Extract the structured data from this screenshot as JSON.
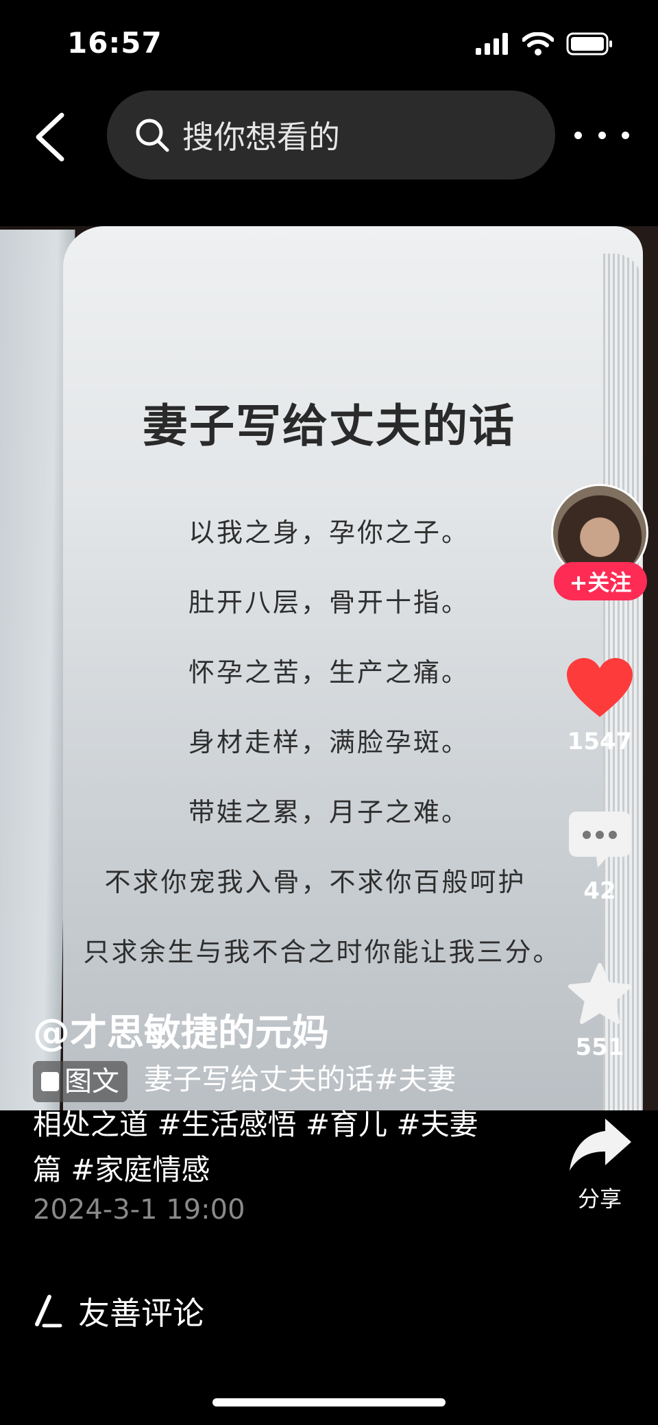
{
  "status_bar": {
    "time": "16:57"
  },
  "search": {
    "placeholder": "搜你想看的"
  },
  "post_image": {
    "title": "妻子写给丈夫的话",
    "lines": [
      "以我之身，孕你之子。",
      "肚开八层，骨开十指。",
      "怀孕之苦，生产之痛。",
      "身材走样，满脸孕斑。",
      "带娃之累，月子之难。",
      "不求你宠我入骨，不求你百般呵护",
      "只求余生与我不合之时你能让我三分。"
    ]
  },
  "actions": {
    "follow_label": "+关注",
    "likes": "1547",
    "comments": "42",
    "favorites": "551",
    "share_label": "分享"
  },
  "post": {
    "author": "@才思敏捷的元妈",
    "type_label": "图文",
    "description_line1": "妻子写给丈夫的话#夫妻",
    "description_line2": "相处之道 #生活感悟 #育儿 #夫妻",
    "description_line3": "篇 #家庭情感",
    "date": "2024-3-1 19:00"
  },
  "comment_bar": {
    "placeholder": "友善评论"
  },
  "colors": {
    "accent": "#fe2c55",
    "like": "#fe3b3b",
    "background": "#000000"
  }
}
